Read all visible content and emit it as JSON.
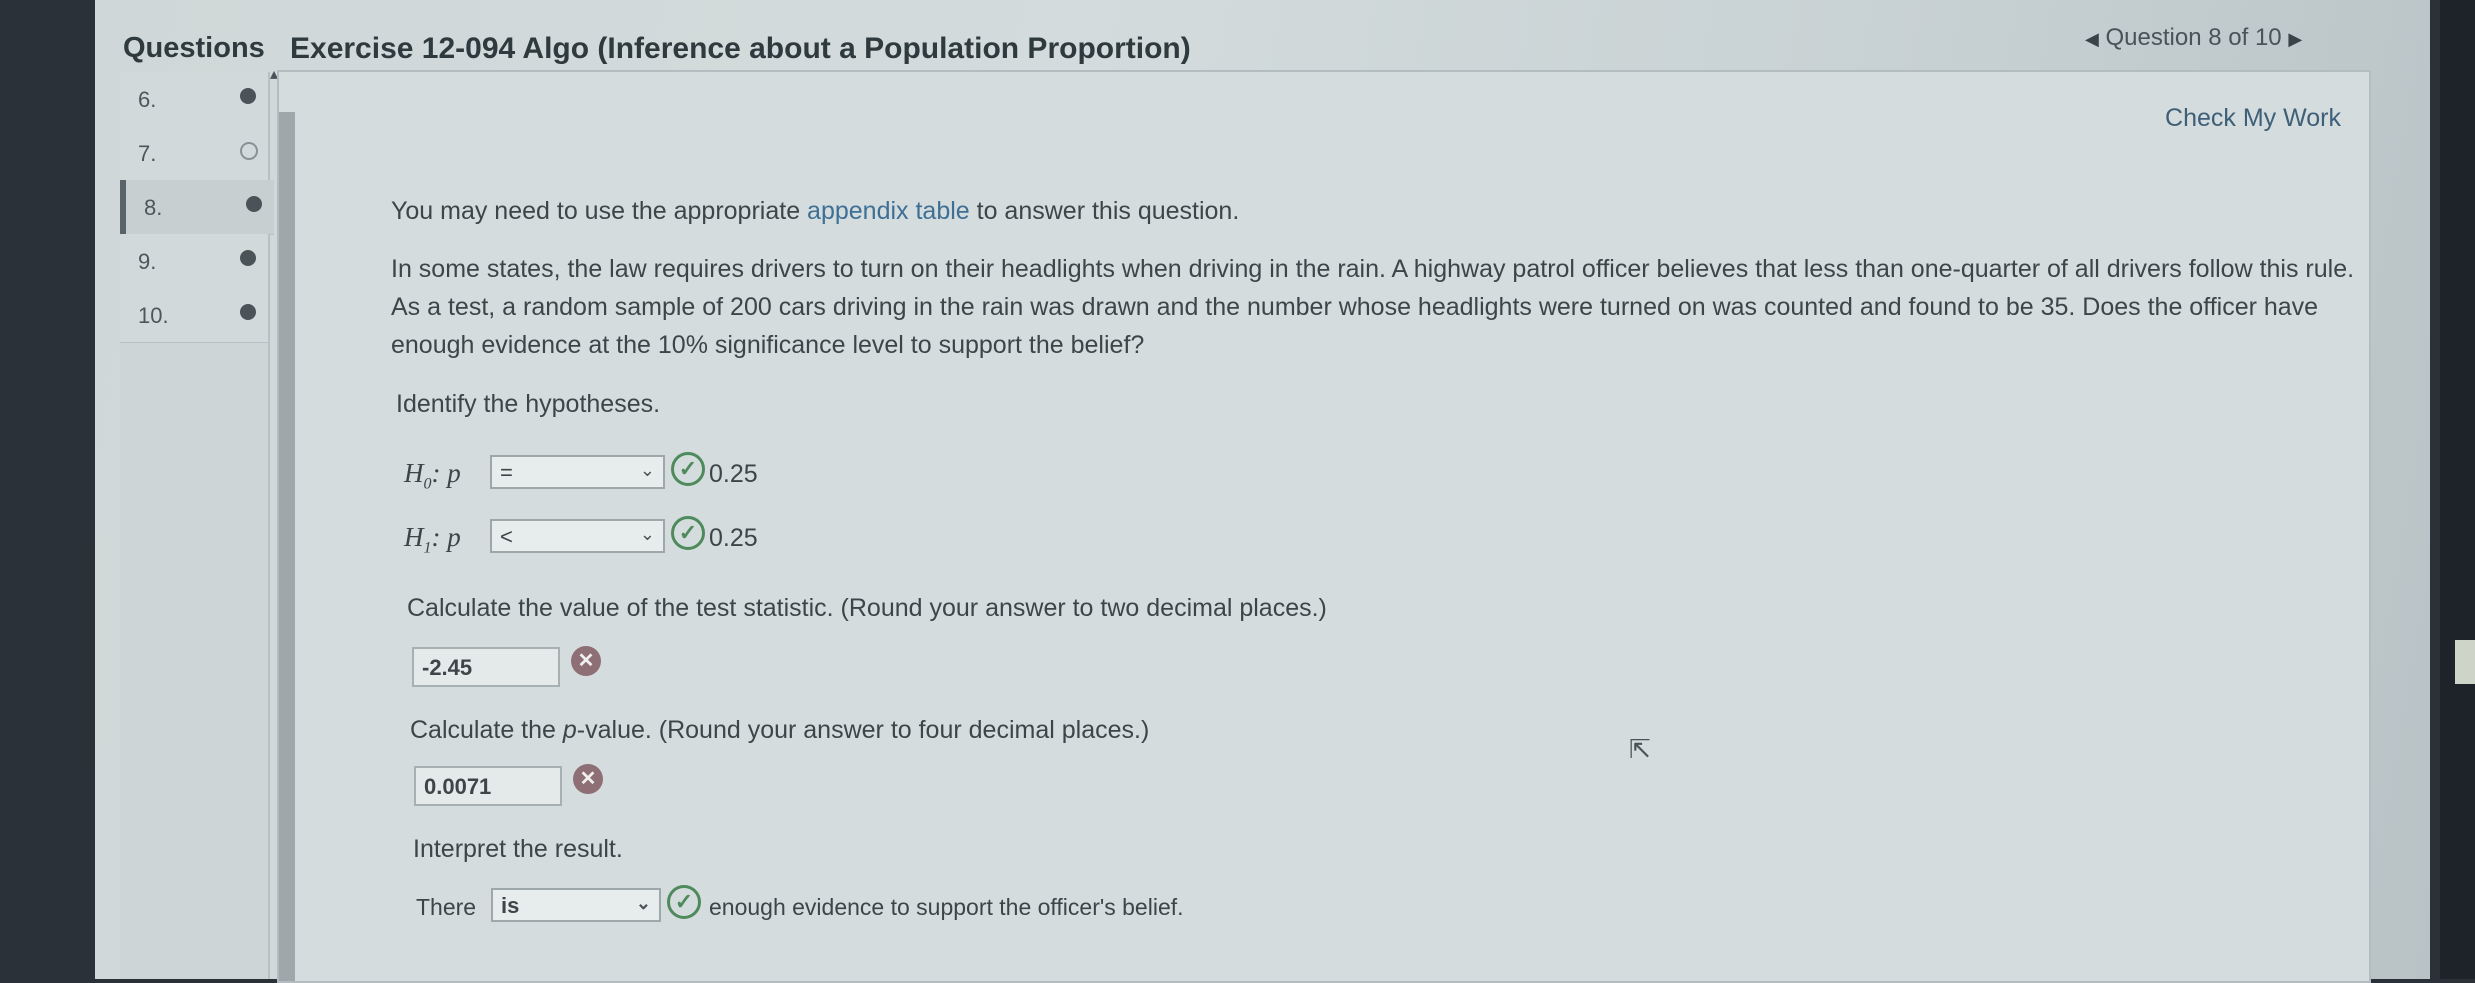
{
  "header": {
    "questions_label": "Questions",
    "exercise_title": "Exercise 12-094 Algo (Inference about a Population Proportion)",
    "question_nav": "Question 8 of 10"
  },
  "sidebar": {
    "items": [
      {
        "num": "6.",
        "status": "complete"
      },
      {
        "num": "7.",
        "status": "empty"
      },
      {
        "num": "8.",
        "status": "complete"
      },
      {
        "num": "9.",
        "status": "complete"
      },
      {
        "num": "10.",
        "status": "complete"
      }
    ]
  },
  "content": {
    "check_my_work": "Check My Work",
    "note_prefix": "You may need to use the appropriate ",
    "note_link": "appendix table",
    "note_suffix": " to answer this question.",
    "problem": "In some states, the law requires drivers to turn on their headlights when driving in the rain. A highway patrol officer believes that less than one-quarter of all drivers follow this rule. As a test, a random sample of 200 cars driving in the rain was drawn and the number whose headlights were turned on was counted and found to be 35. Does the officer have enough evidence at the 10% significance level to support the belief?",
    "identify": "Identify the hypotheses.",
    "h0_label": "H",
    "h0_sub": "0",
    "h0_p": ": p",
    "h0_select": "=",
    "h0_value": "0.25",
    "h1_label": "H",
    "h1_sub": "1",
    "h1_p": ": p",
    "h1_select": "<",
    "h1_value": "0.25",
    "test_stat_prompt": "Calculate the value of the test statistic. (Round your answer to two decimal places.)",
    "test_stat_value": "-2.45",
    "pvalue_prompt_a": "Calculate the ",
    "pvalue_prompt_p": "p",
    "pvalue_prompt_b": "-value. (Round your answer to four decimal places.)",
    "pvalue_value": "0.0071",
    "interpret": "Interpret the result.",
    "there": "There",
    "is_select": "is",
    "conclusion": "enough evidence to support the officer's belief."
  },
  "icons": {
    "check_mark": "✓",
    "wrong_mark": "✕",
    "chevron": "⌄",
    "nav_prev": "◀",
    "nav_next": "▶"
  },
  "colors": {
    "link": "#3e6f95",
    "correct": "#4f8a5c",
    "incorrect": "#8e6f75"
  }
}
